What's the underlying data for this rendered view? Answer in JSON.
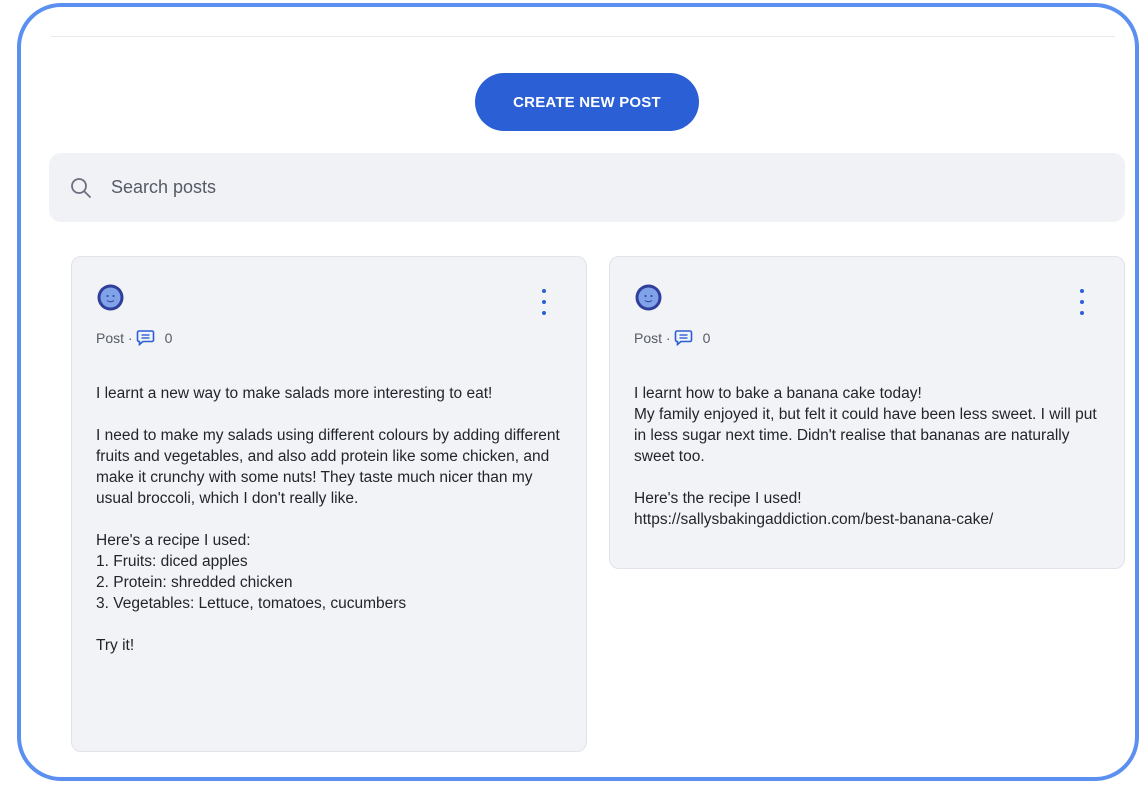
{
  "toolbar": {
    "create_label": "CREATE NEW POST"
  },
  "search": {
    "placeholder": "Search posts",
    "value": ""
  },
  "colors": {
    "accent": "#2b5fd6",
    "frame_border": "#5b8ff0",
    "card_bg": "#f2f3f7"
  },
  "posts": [
    {
      "type_label": "Post ·",
      "comment_count": "0",
      "body": "I learnt a new way to make salads more interesting to eat!\n\nI need to make my salads using different colours by adding different fruits and vegetables, and also add protein like some chicken, and make it crunchy with some nuts! They taste much nicer than my usual broccoli, which I don't really like.\n\nHere's a recipe I used:\n1. Fruits: diced apples\n2. Protein: shredded chicken\n3. Vegetables: Lettuce, tomatoes, cucumbers\n\nTry it!",
      "avatar_icon": "smiley-avatar-icon",
      "menu_icon": "vertical-dots-icon"
    },
    {
      "type_label": "Post ·",
      "comment_count": "0",
      "body": "I learnt how to bake a banana cake today!\nMy family enjoyed it, but felt it could have been less sweet. I will put in less sugar next time. Didn't realise that bananas are naturally sweet too.\n\nHere's the recipe I used!\nhttps://sallysbakingaddiction.com/best-banana-cake/",
      "avatar_icon": "smiley-avatar-icon",
      "menu_icon": "vertical-dots-icon"
    }
  ]
}
